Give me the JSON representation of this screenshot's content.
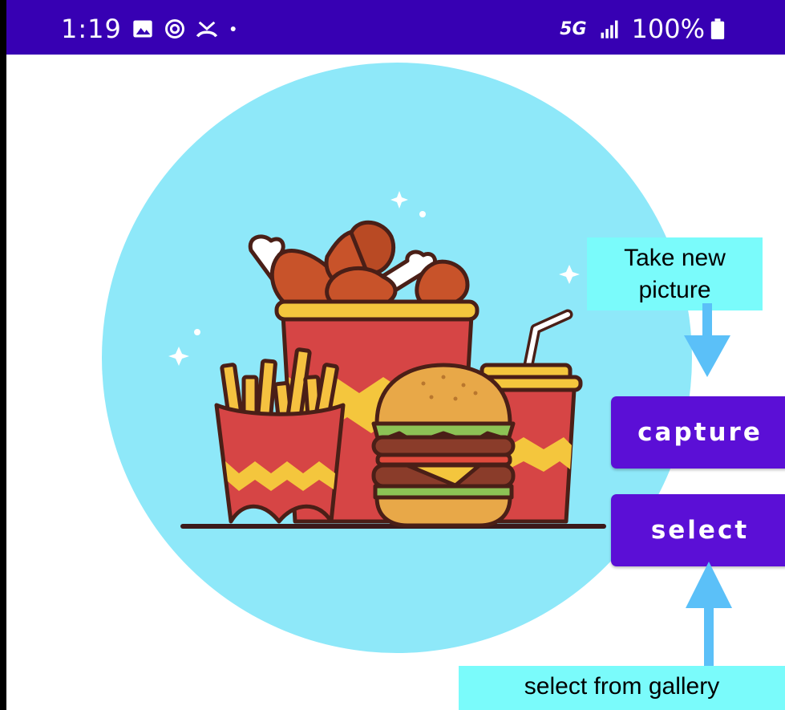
{
  "status_bar": {
    "time": "1:19",
    "icons": [
      "gallery-icon",
      "sync-icon",
      "missed-call-icon",
      "dot-icon"
    ],
    "network": "5G",
    "signal_icon": "signal-bars-icon",
    "battery": "100%",
    "battery_icon": "battery-full-icon",
    "background": "#3700b3"
  },
  "buttons": {
    "capture_label": "capture",
    "select_label": "select",
    "color": "#5b0fd6"
  },
  "callouts": {
    "take_new_picture": "Take new\npicture",
    "select_from_gallery": "select from gallery",
    "background": "#7afbfb",
    "arrow_color": "#5bc0f8"
  },
  "image": {
    "subject": "fast-food-illustration",
    "circle_color": "#8ee8f9"
  }
}
